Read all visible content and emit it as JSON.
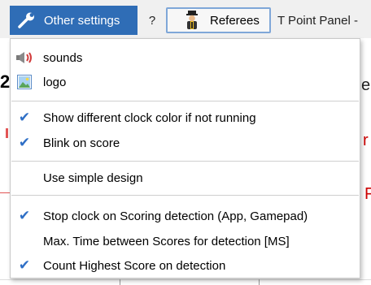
{
  "toolbar": {
    "other_settings_label": "Other settings",
    "other_settings_icon": "wrench-icon",
    "help_label": "?",
    "referees_label": "Referees",
    "referees_icon": "referee-icon",
    "panel_title": "T Point Panel -"
  },
  "background": {
    "big_digit": "2",
    "fragment_e": "e",
    "fragment_r": "r",
    "fragment_f": "F"
  },
  "menu": {
    "items": [
      {
        "label": "sounds",
        "icon": "speaker-icon",
        "checked": false
      },
      {
        "label": "logo",
        "icon": "image-icon",
        "checked": false
      },
      {
        "label": "Show different clock color if not running",
        "checked": true
      },
      {
        "label": "Blink on score",
        "checked": true
      },
      {
        "label": "Use simple design",
        "checked": false
      },
      {
        "label": "Stop clock on Scoring detection (App, Gamepad)",
        "checked": true
      },
      {
        "label": "Max. Time between Scores for detection [MS]",
        "checked": false
      },
      {
        "label": "Count Highest Score on detection",
        "checked": true
      }
    ],
    "check_glyph": "✔",
    "check_color": "#2f6fc6"
  },
  "colors": {
    "accent": "#2f6db6",
    "button_border": "#7fa7d8"
  }
}
